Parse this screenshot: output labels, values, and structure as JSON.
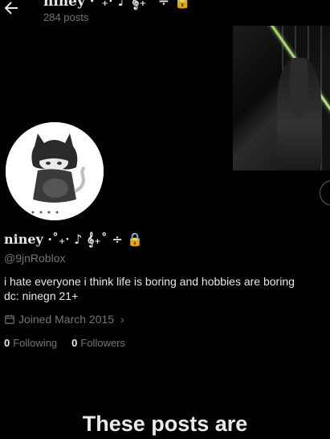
{
  "header": {
    "title": "niney ·˚₊‧ ♪ 𝄞₊˚ ÷ 🔒",
    "posts_count": "284 posts"
  },
  "profile": {
    "display_name": "niney ·˚₊‧ ♪ 𝄞₊˚ ÷ 🔒",
    "handle": "@9jnRoblox",
    "bio_line1": "i hate everyone i think life is boring and hobbies are boring",
    "bio_line2": "dc: ninegn 21+",
    "joined": "Joined March 2015",
    "following_count": "0",
    "following_label": "Following",
    "followers_count": "0",
    "followers_label": "Followers"
  },
  "notice": {
    "headline": "These posts are"
  },
  "colors": {
    "background": "#000000",
    "primary_text": "#e7e9ea",
    "secondary_text": "#71767b"
  },
  "icons": [
    "back-arrow-icon",
    "calendar-icon",
    "chevron-right-icon",
    "lock-icon"
  ]
}
